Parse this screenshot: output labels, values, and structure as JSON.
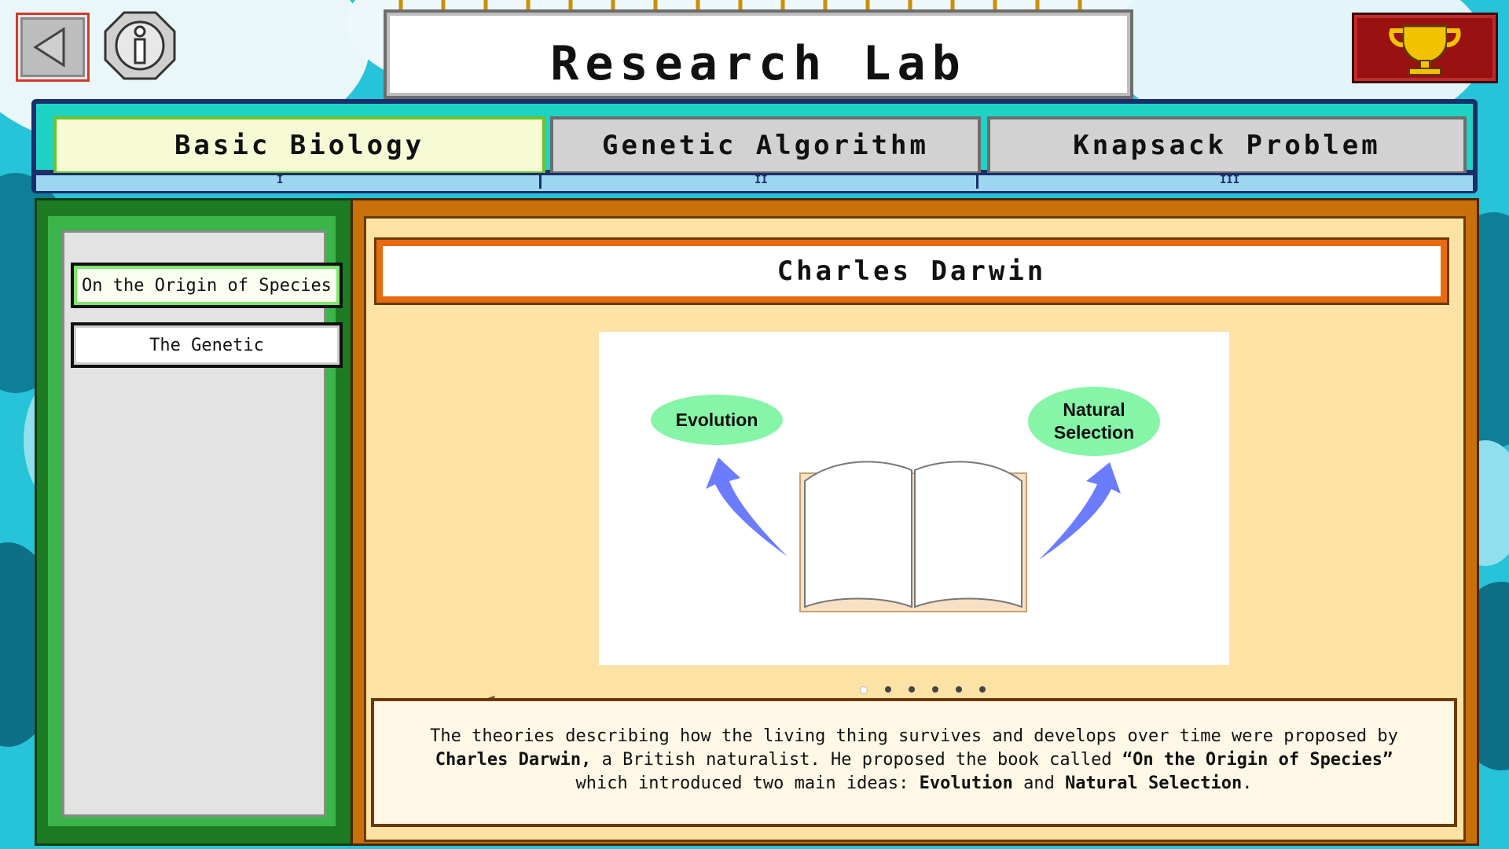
{
  "header": {
    "title": "Research Lab"
  },
  "tabs": [
    {
      "label": "Basic Biology",
      "numeral": "I",
      "active": true
    },
    {
      "label": "Genetic Algorithm",
      "numeral": "II",
      "active": false
    },
    {
      "label": "Knapsack Problem",
      "numeral": "III",
      "active": false
    }
  ],
  "sidebar": {
    "items": [
      {
        "label": "On the Origin of Species",
        "selected": true
      },
      {
        "label": "The Genetic",
        "selected": false
      }
    ]
  },
  "content": {
    "heading": "Charles Darwin",
    "illustration": {
      "left_label": "Evolution",
      "right_label_line1": "Natural",
      "right_label_line2": "Selection"
    },
    "pagination": {
      "count": 6,
      "current": 1
    },
    "description": {
      "p1": "The theories describing how the living thing survives and develops over time were proposed by",
      "b1": "Charles Darwin,",
      "p2": " a British naturalist. He proposed the book called ",
      "b2": "“On the Origin of Species”",
      "p3": "which introduced two main ideas: ",
      "b3": "Evolution",
      "p4": " and ",
      "b4": "Natural Selection",
      "p5": "."
    }
  },
  "colors": {
    "background": "#27c3d8",
    "tab_active": "#f6fbd5",
    "panel_green": "#3bb54a",
    "panel_orange": "#c8700a",
    "content_bg": "#fde2a6",
    "oval": "#86f5a8",
    "arrow_blue": "#6b7cff",
    "trophy": "#9a1111"
  },
  "icons": [
    "back-arrow-icon",
    "info-icon",
    "trophy-icon",
    "prev-arrow-icon",
    "next-arrow-icon",
    "book-icon",
    "curved-arrow-icon"
  ]
}
